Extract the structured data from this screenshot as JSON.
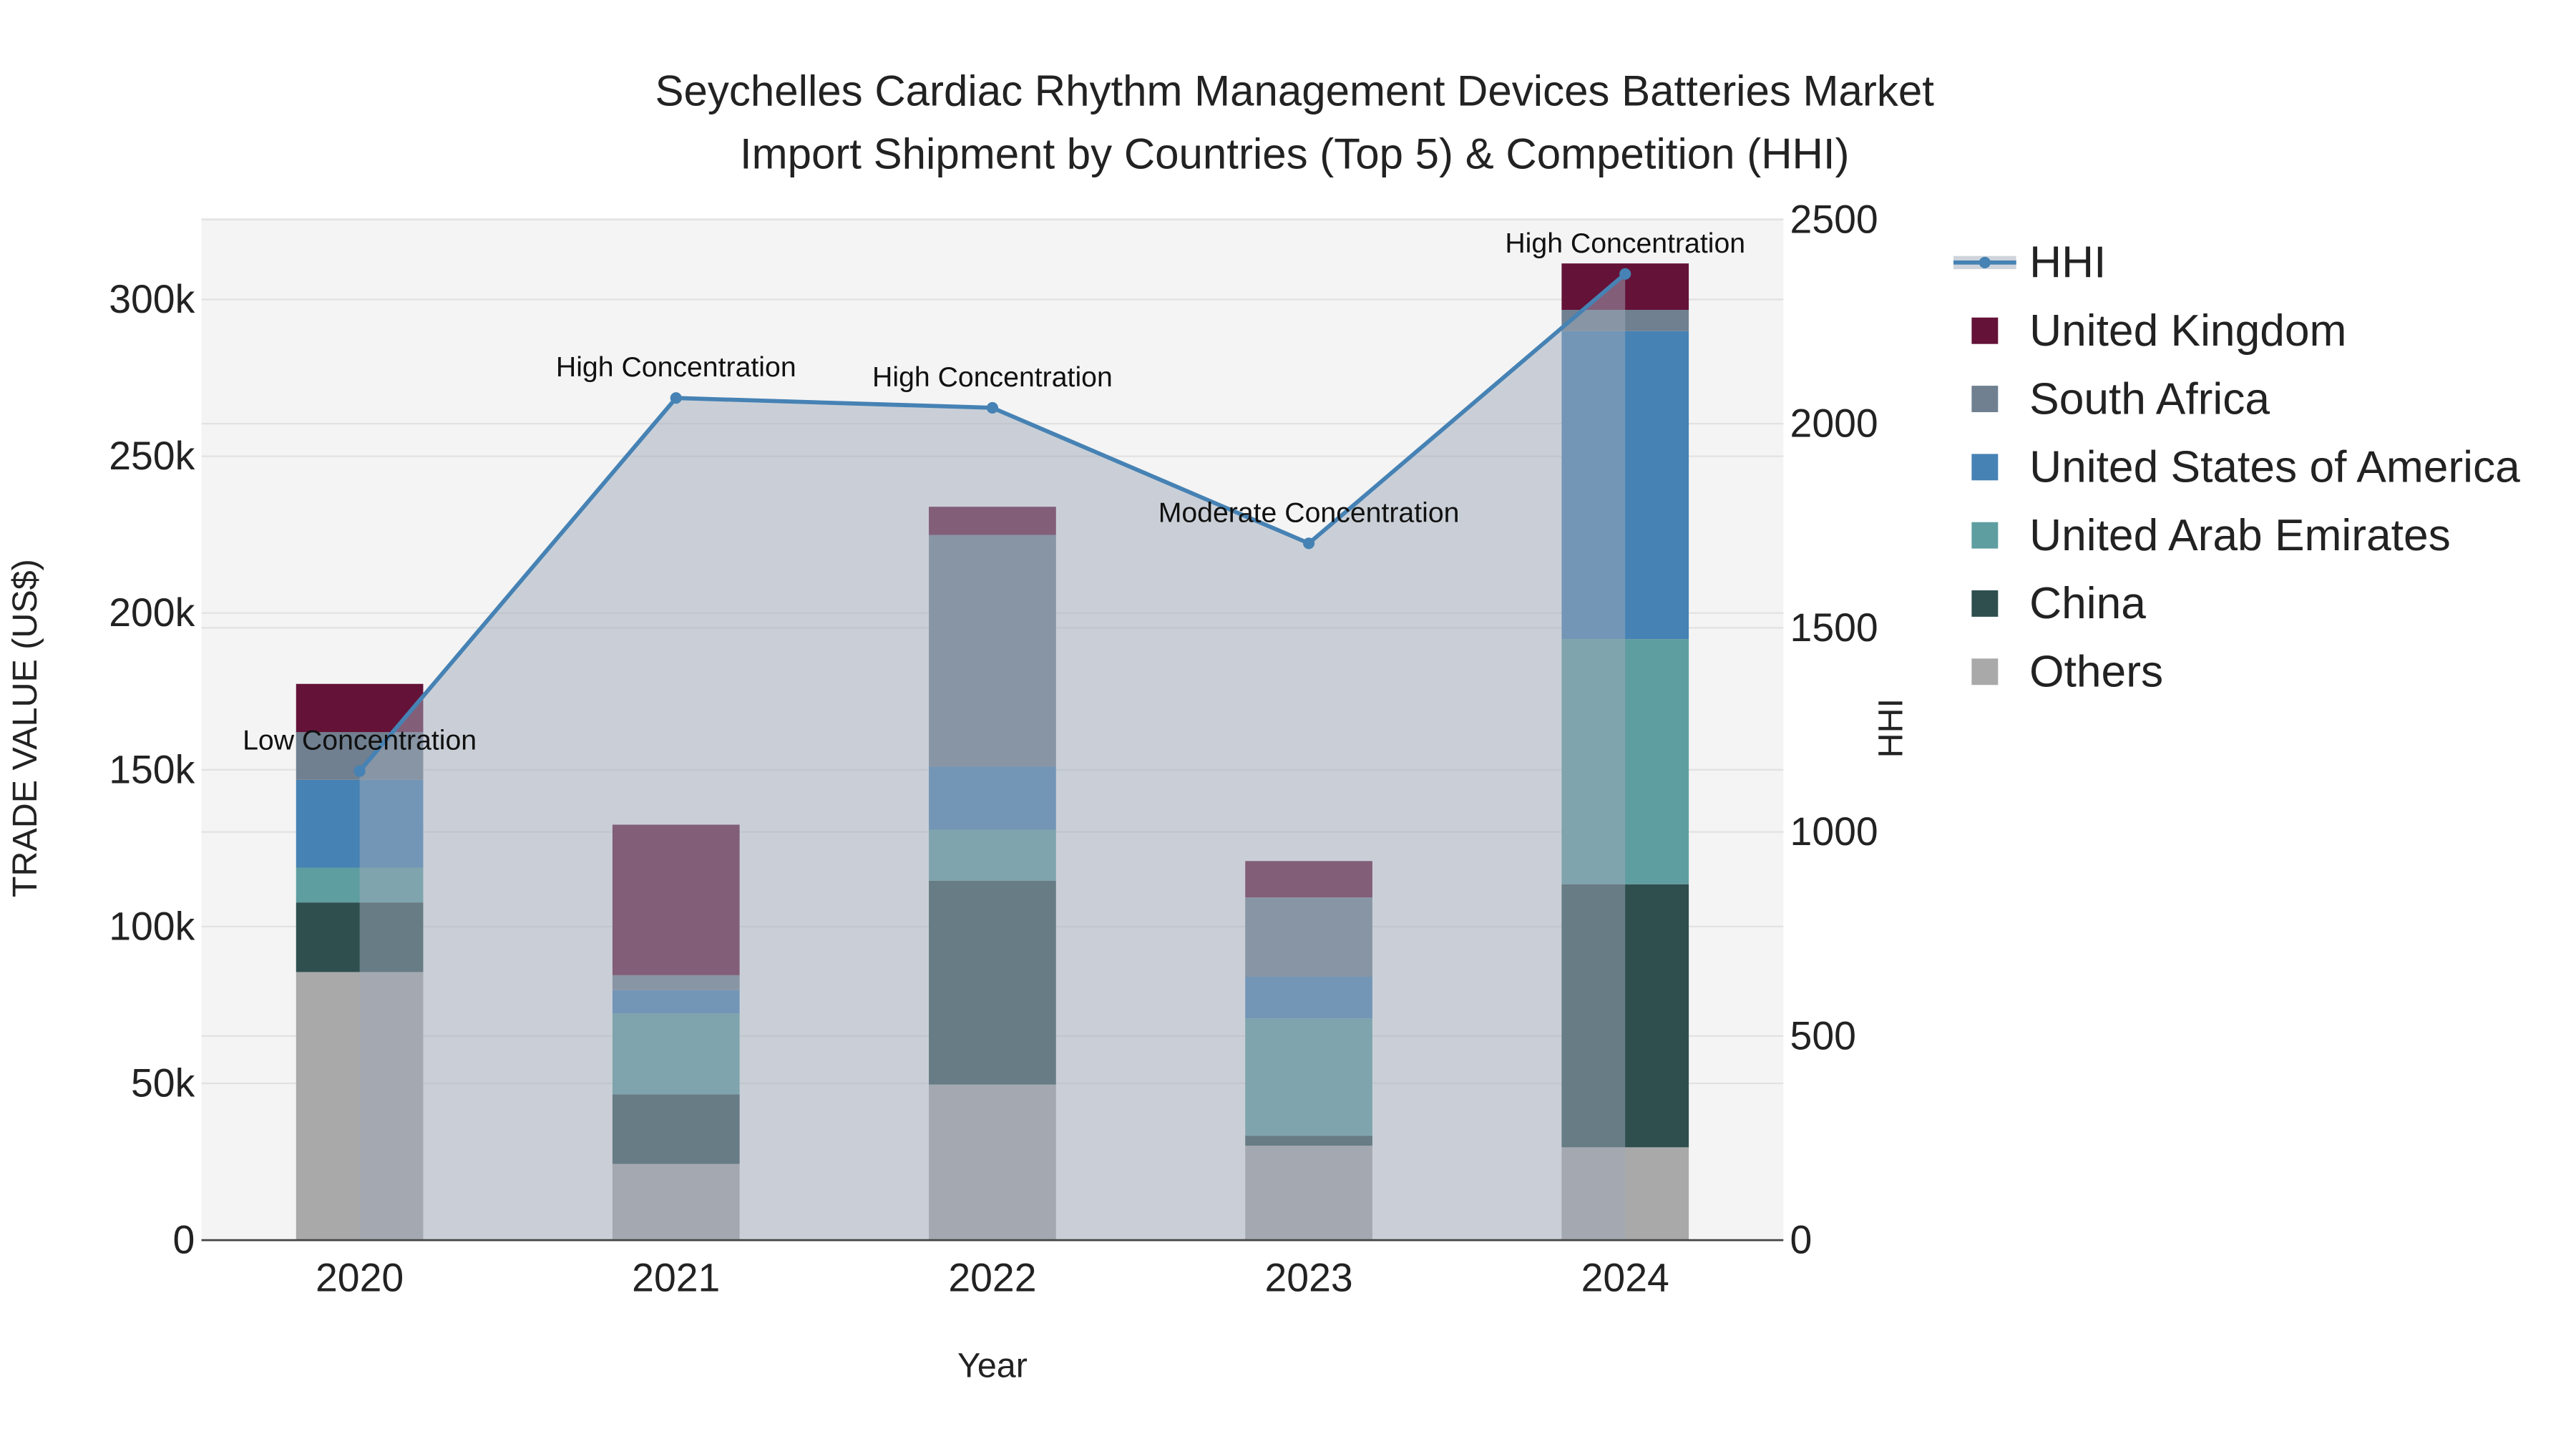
{
  "chart_data": {
    "type": "bar",
    "title_line1": "Seychelles Cardiac Rhythm Management Devices Batteries Market",
    "title_line2": "Import Shipment by Countries (Top 5) & Competition (HHI)",
    "xlabel": "Year",
    "ylabel": "TRADE VALUE (US$)",
    "y2label": "HHI",
    "categories": [
      "2020",
      "2021",
      "2022",
      "2023",
      "2024"
    ],
    "ylim": [
      0,
      326000
    ],
    "y2lim": [
      0,
      2500
    ],
    "yticks": [
      0,
      50000,
      100000,
      150000,
      200000,
      250000,
      300000
    ],
    "ytick_labels": [
      "0",
      "50k",
      "100k",
      "150k",
      "200k",
      "250k",
      "300k"
    ],
    "y2ticks": [
      0,
      500,
      1000,
      1500,
      2000,
      2500
    ],
    "y2tick_labels": [
      "0",
      "500",
      "1000",
      "1500",
      "2000",
      "2500"
    ],
    "series": [
      {
        "name": "Others",
        "color": "#A9A9A9",
        "values": [
          85500,
          24300,
          49600,
          30100,
          29600
        ]
      },
      {
        "name": "China",
        "color": "#2F4F4F",
        "values": [
          22200,
          22200,
          65000,
          3200,
          83900
        ]
      },
      {
        "name": "United Arab Emirates",
        "color": "#5F9EA0",
        "values": [
          11100,
          25800,
          16300,
          37400,
          78200
        ]
      },
      {
        "name": "United States of America",
        "color": "#4682B4",
        "values": [
          28000,
          7400,
          20100,
          13300,
          98200
        ]
      },
      {
        "name": "South Africa",
        "color": "#708090",
        "values": [
          15200,
          4800,
          73900,
          25300,
          6800
        ]
      },
      {
        "name": "United Kingdom",
        "color": "#641238",
        "values": [
          15400,
          48000,
          9000,
          11600,
          14800
        ]
      }
    ],
    "hhi": {
      "name": "HHI",
      "color": "#4682B4",
      "values": [
        1149,
        2063,
        2039,
        1707,
        2367
      ]
    },
    "annotations": [
      "Low Concentration",
      "High Concentration",
      "High Concentration",
      "Moderate Concentration",
      "High Concentration"
    ],
    "legend_order": [
      "HHI",
      "United Kingdom",
      "South Africa",
      "United States of America",
      "United Arab Emirates",
      "China",
      "Others"
    ],
    "legend_position": "right",
    "grid": true
  }
}
